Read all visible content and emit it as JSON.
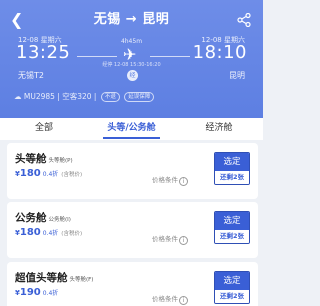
{
  "header": {
    "back_icon": "back-arrow-icon",
    "route": "无锡 → 昆明",
    "share_icon": "share-icon"
  },
  "flight": {
    "dep_date": "12-08 星期六",
    "dep_time": "13:25",
    "dep_airport": "无锡T2",
    "arr_date": "12-08 星期六",
    "arr_time": "18:10",
    "arr_airport": "昆明",
    "duration": "4h45m",
    "stop_note": "经停 12-08 15:30-16:20",
    "stop_badge": "经",
    "info_text": "MU2985 | 空客320 |",
    "tag1": "不退",
    "tag2": "延误保障"
  },
  "tabs": [
    "全部",
    "头等/公务舱",
    "经济舱"
  ],
  "cards": [
    {
      "name": "头等舱",
      "sub": "头等舱(P)",
      "yen": "¥",
      "price": "180",
      "discount": "0.4折",
      "tax": "(含税价)",
      "terms": "价格条件",
      "btn": "选定",
      "btn_sub": "还剩2张"
    },
    {
      "name": "公务舱",
      "sub": "公务舱(I)",
      "yen": "¥",
      "price": "180",
      "discount": "0.4折",
      "tax": "(含税价)",
      "terms": "价格条件",
      "btn": "选定",
      "btn_sub": "还剩2张"
    },
    {
      "name": "超值头等舱",
      "sub": "头等舱(F)",
      "yen": "¥",
      "price": "190",
      "discount": "0.4折",
      "tax": "",
      "terms": "价格条件",
      "btn": "选定",
      "btn_sub": "还剩2张"
    }
  ],
  "colors": {
    "accent": "#3a5fd6",
    "hero": "#6e8de8"
  }
}
